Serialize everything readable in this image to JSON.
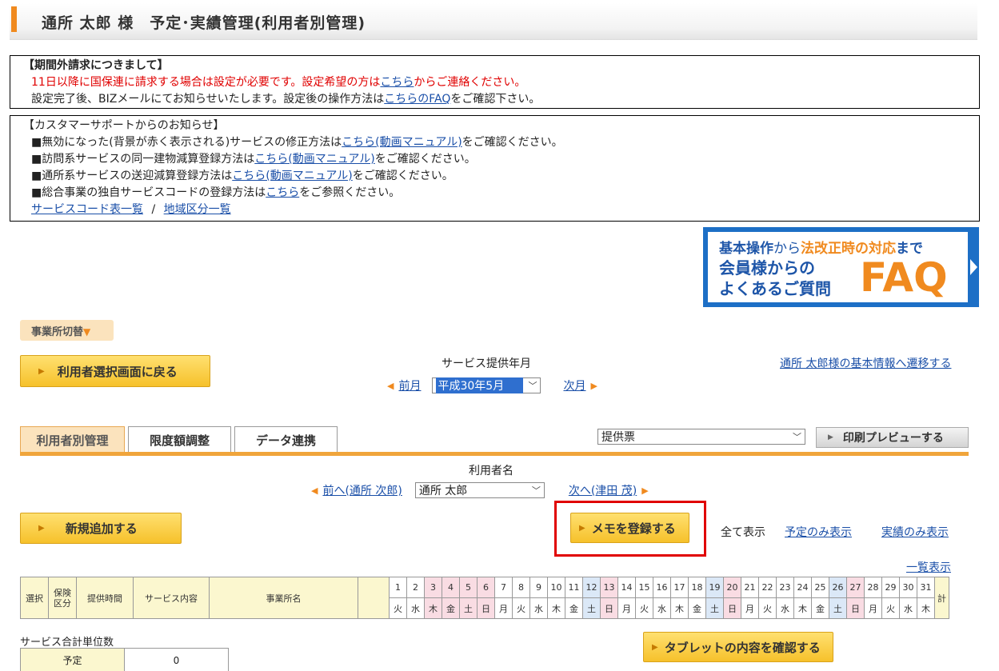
{
  "header": {
    "title": "通所 太郎 様　予定･実績管理(利用者別管理)"
  },
  "notice1": {
    "heading": "【期間外請求につきまして】",
    "line1_pre": "11日以降に国保連に請求する場合は設定が必要です。設定希望の方は",
    "line1_link": "こちら",
    "line1_post": "からご連絡ください。",
    "line2_pre": "設定完了後、BIZメールにてお知らせいたします。設定後の操作方法は",
    "line2_link": "こちらのFAQ",
    "line2_post": "をご確認下さい。"
  },
  "notice2": {
    "heading": "【カスタマーサポートからのお知らせ】",
    "items": [
      {
        "pre": "■無効になった(背景が赤く表示される)サービスの修正方法は",
        "link": "こちら(動画マニュアル)",
        "post": "をご確認ください。"
      },
      {
        "pre": "■訪問系サービスの同一建物減算登録方法は",
        "link": "こちら(動画マニュアル)",
        "post": "をご確認ください。"
      },
      {
        "pre": "■通所系サービスの送迎減算登録方法は",
        "link": "こちら(動画マニュアル)",
        "post": "をご確認ください。"
      },
      {
        "pre": "■総合事業の独自サービスコードの登録方法は",
        "link": "こちら",
        "post": "をご参照ください。"
      }
    ],
    "link_a": "サービスコード表一覧",
    "sep": "/",
    "link_b": "地域区分一覧"
  },
  "faq_banner": {
    "line1_a": "基本操作",
    "line1_b": "から",
    "line1_c": "法改正時の対応",
    "line1_d": "まで",
    "line2": "会員様からの",
    "line3": "よくあるご質問",
    "big": "FAQ"
  },
  "office_switch": {
    "label": "事業所切替",
    "arrow": "▼"
  },
  "back_button": "利用者選択画面に戻る",
  "month_nav": {
    "label": "サービス提供年月",
    "prev": "前月",
    "next": "次月",
    "selected": "平成30年5月"
  },
  "basic_info_link": "通所 太郎様の基本情報へ遷移する",
  "tabs": [
    "利用者別管理",
    "限度額調整",
    "データ連携"
  ],
  "print": {
    "selected": "提供票",
    "button": "印刷プレビューする"
  },
  "user_nav": {
    "label": "利用者名",
    "prev": "前へ(通所 次郎)",
    "selected": "通所 太郎",
    "next": "次へ(津田 茂)"
  },
  "buttons": {
    "add_new": "新規追加する",
    "memo": "メモを登録する",
    "tablet": "タブレットの内容を確認する"
  },
  "filters": {
    "all": "全て表示",
    "plan_only": "予定のみ表示",
    "actual_only": "実績のみ表示",
    "list_view": "一覧表示"
  },
  "table": {
    "headers": {
      "select": "選択",
      "insurance": "保険\n区分",
      "time": "提供時間",
      "service": "サービス内容",
      "office": "事業所名",
      "total": "計"
    },
    "days": [
      "1",
      "2",
      "3",
      "4",
      "5",
      "6",
      "7",
      "8",
      "9",
      "10",
      "11",
      "12",
      "13",
      "14",
      "15",
      "16",
      "17",
      "18",
      "19",
      "20",
      "21",
      "22",
      "23",
      "24",
      "25",
      "26",
      "27",
      "28",
      "29",
      "30",
      "31"
    ],
    "weekdays": [
      "火",
      "水",
      "木",
      "金",
      "土",
      "日",
      "月",
      "火",
      "水",
      "木",
      "金",
      "土",
      "日",
      "月",
      "火",
      "水",
      "木",
      "金",
      "土",
      "日",
      "月",
      "火",
      "水",
      "木",
      "金",
      "土",
      "日",
      "月",
      "火",
      "水",
      "木"
    ],
    "day_types": [
      "n",
      "n",
      "h",
      "h",
      "h",
      "h",
      "n",
      "n",
      "n",
      "n",
      "n",
      "s",
      "h",
      "n",
      "n",
      "n",
      "n",
      "n",
      "s",
      "h",
      "n",
      "n",
      "n",
      "n",
      "n",
      "s",
      "h",
      "n",
      "n",
      "n",
      "n"
    ]
  },
  "summary": {
    "title": "サービス合計単位数",
    "row_label": "予定",
    "row_value": "0"
  }
}
